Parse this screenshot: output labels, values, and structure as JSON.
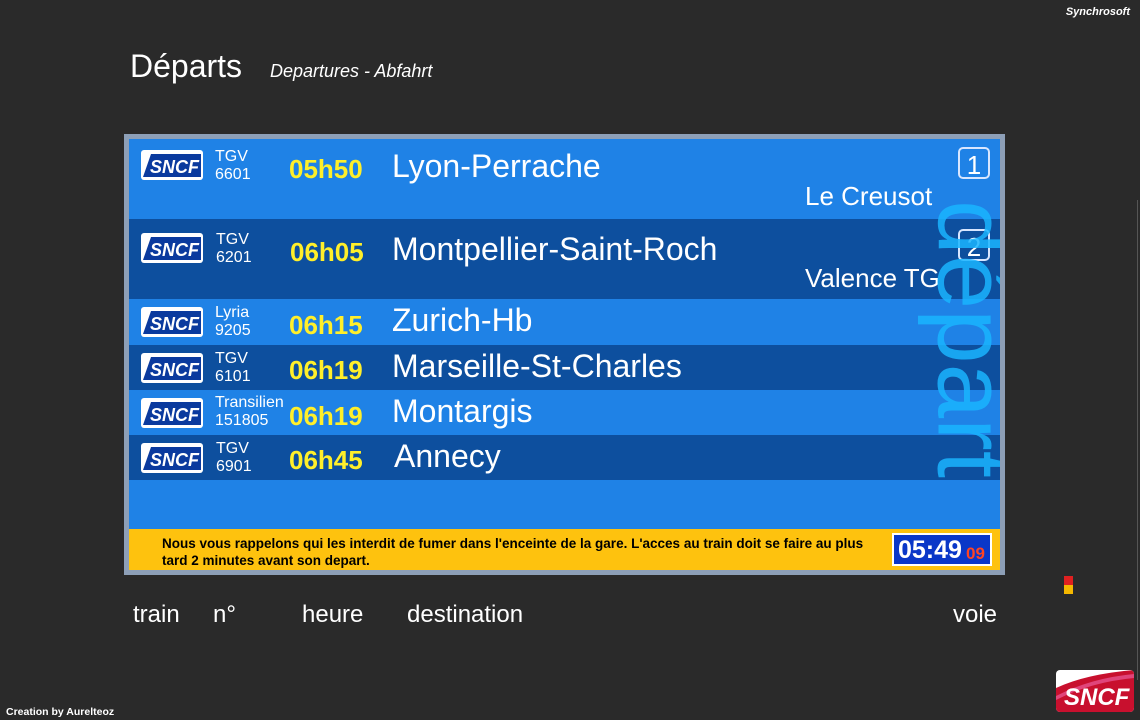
{
  "brand": "Synchrosoft",
  "header": {
    "title": "Départs",
    "subtitle": "Departures - Abfahrt"
  },
  "board": {
    "rows": [
      {
        "type": "TGV",
        "number": "6601",
        "time": "05h50",
        "destination": "Lyon-Perrache",
        "via": "Le Creusot",
        "platform": "1"
      },
      {
        "type": "TGV",
        "number": "6201",
        "time": "06h05",
        "destination": "Montpellier-Saint-Roch",
        "via": "Valence TG",
        "platform": "2"
      },
      {
        "type": "Lyria",
        "number": "9205",
        "time": "06h15",
        "destination": "Zurich-Hb"
      },
      {
        "type": "TGV",
        "number": "6101",
        "time": "06h19",
        "destination": "Marseille-St-Charles"
      },
      {
        "type": "Transilien",
        "number": "151805",
        "time": "06h19",
        "destination": "Montargis"
      },
      {
        "type": "TGV",
        "number": "6901",
        "time": "06h45",
        "destination": "Annecy"
      }
    ],
    "vertical_label": "départ",
    "ticker": "Nous vous rappelons qui les interdit de fumer dans l'enceinte de la gare. L'acces au train doit se faire au plus tard 2 minutes avant son depart.",
    "clock": {
      "time": "05:49",
      "seconds": "09"
    }
  },
  "columns": {
    "train": "train",
    "number": "n°",
    "time": "heure",
    "destination": "destination",
    "platform": "voie"
  },
  "footer": {
    "credit": "Creation by Aurelteoz",
    "logo": "SNCF"
  },
  "logo_text": "SNCF",
  "colors": {
    "light_row": "#1f82e6",
    "dark_row": "#0d4f9e",
    "time": "#ffef2a",
    "ticker": "#fec20e",
    "clock": "#0a37c8",
    "vertical": "#1ab5ff",
    "background": "#2a2a2a"
  }
}
